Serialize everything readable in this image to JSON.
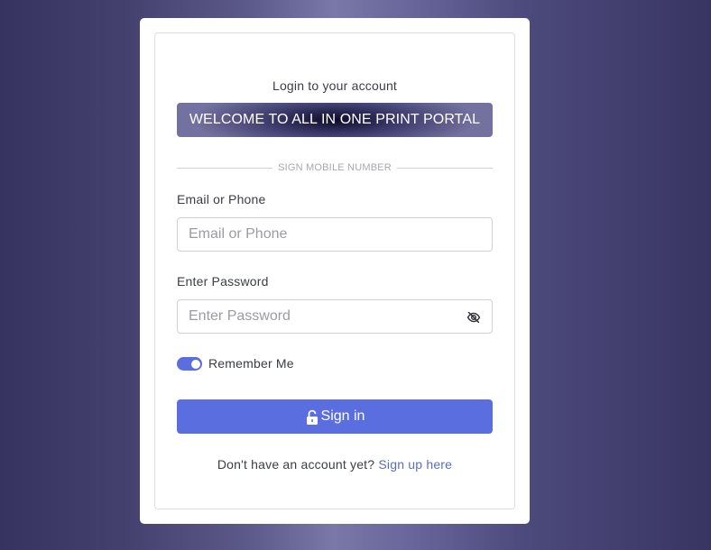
{
  "login": {
    "heading": "Login to your account",
    "banner": "WELCOME TO ALL IN ONE PRINT PORTAL",
    "divider_text": "SIGN MOBILE NUMBER",
    "email_label": "Email or Phone",
    "email_placeholder": "Email or Phone",
    "email_value": "",
    "password_label": "Enter Password",
    "password_placeholder": "Enter Password",
    "password_value": "",
    "remember_label": "Remember Me",
    "remember_on": true,
    "signin_label": "Sign in",
    "footer_text": "Don't have an account yet?",
    "signup_link": "Sign up here"
  },
  "colors": {
    "accent": "#5b6ee0",
    "link": "#5b6ec6",
    "background_dark": "#363361",
    "background_light": "#7a78a8"
  },
  "icons": {
    "password_toggle": "eye-slash-icon",
    "signin": "unlock-icon"
  }
}
